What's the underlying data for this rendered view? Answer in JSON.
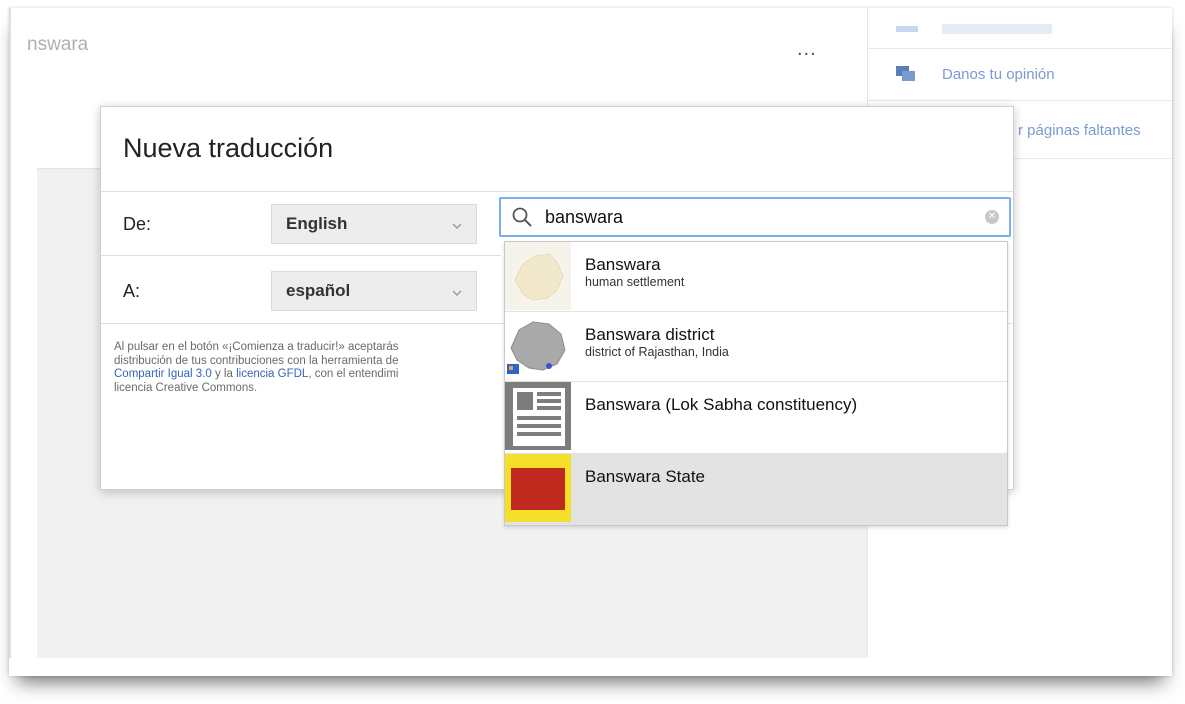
{
  "background_page": {
    "title_fragment": "nswara",
    "more_menu_label": "...",
    "side_panel": {
      "items": [
        {
          "label": "Danos tu opinión",
          "icon": "feedback-icon"
        },
        {
          "label": "r páginas faltantes",
          "icon": "missing-pages-icon"
        }
      ]
    }
  },
  "dialog": {
    "title": "Nueva traducción",
    "from_label": "De:",
    "from_value": "English",
    "to_label": "A:",
    "to_value": "español",
    "terms": {
      "line1": "Al pulsar en el botón «¡Comienza a traducir!» aceptarás",
      "line2": "distribución de tus contribuciones con la herramienta de",
      "link1": "Compartir Igual 3.0",
      "mid3": " y la ",
      "link2": "licencia GFDL",
      "tail3": ", con el entendimi",
      "line4": "licencia Creative Commons."
    }
  },
  "search": {
    "query": "banswara",
    "icon": "search-icon",
    "clear_icon": "clear-icon"
  },
  "suggestions": [
    {
      "title": "Banswara",
      "description": "human settlement",
      "thumb": "rajasthan-map"
    },
    {
      "title": "Banswara district",
      "description": "district of Rajasthan, India",
      "thumb": "district-map"
    },
    {
      "title": "Banswara (Lok Sabha constituency)",
      "description": "",
      "thumb": "article-placeholder"
    },
    {
      "title": "Banswara State",
      "description": "",
      "thumb": "flag"
    }
  ],
  "colors": {
    "accent_focus": "#7aaef0",
    "link": "#3366bb",
    "flag_red": "#c0291d",
    "flag_yellow": "#f4e02a"
  }
}
